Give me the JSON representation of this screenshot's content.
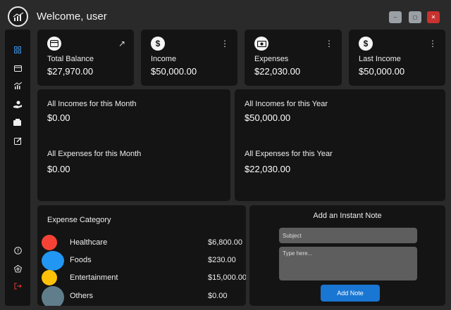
{
  "header": {
    "welcome": "Welcome, user",
    "window_controls": {
      "minimize": "–",
      "maximize": "◻",
      "close": "✕"
    }
  },
  "sidebar": {
    "items": [
      {
        "icon": "dashboard-icon"
      },
      {
        "icon": "card-icon"
      },
      {
        "icon": "chart-icon"
      },
      {
        "icon": "hand-coin-icon"
      },
      {
        "icon": "wallet-icon"
      },
      {
        "icon": "edit-icon"
      }
    ],
    "bottom": [
      {
        "icon": "help-icon"
      },
      {
        "icon": "settings-icon"
      },
      {
        "icon": "logout-icon"
      }
    ]
  },
  "cards": [
    {
      "label": "Total Balance",
      "value": "$27,970.00",
      "icon": "card-icon",
      "action": "↗"
    },
    {
      "label": "Income",
      "value": "$50,000.00",
      "icon": "dollar-icon",
      "action": "⋮"
    },
    {
      "label": "Expenses",
      "value": "$22,030.00",
      "icon": "cash-icon",
      "action": "⋮"
    },
    {
      "label": "Last Income",
      "value": "$50,000.00",
      "icon": "dollar-icon",
      "action": "⋮"
    }
  ],
  "month": {
    "income_label": "All Incomes for this Month",
    "income_value": "$0.00",
    "expense_label": "All Expenses for this Month",
    "expense_value": "$0.00"
  },
  "year": {
    "income_label": "All Incomes for this Year",
    "income_value": "$50,000.00",
    "expense_label": "All Expenses for this Year",
    "expense_value": "$22,030.00"
  },
  "expense_category": {
    "title": "Expense Category",
    "items": [
      {
        "name": "Healthcare",
        "amount": "$6,800.00",
        "color": "#f44336"
      },
      {
        "name": "Foods",
        "amount": "$230.00",
        "color": "#2196f3"
      },
      {
        "name": "Entertainment",
        "amount": "$15,000.00",
        "color": "#ffc107"
      },
      {
        "name": "Others",
        "amount": "$0.00",
        "color": "#607d8b"
      }
    ]
  },
  "note": {
    "title": "Add an Instant Note",
    "subject_placeholder": "Subject",
    "body_placeholder": "Type here...",
    "button_label": "Add Note"
  }
}
